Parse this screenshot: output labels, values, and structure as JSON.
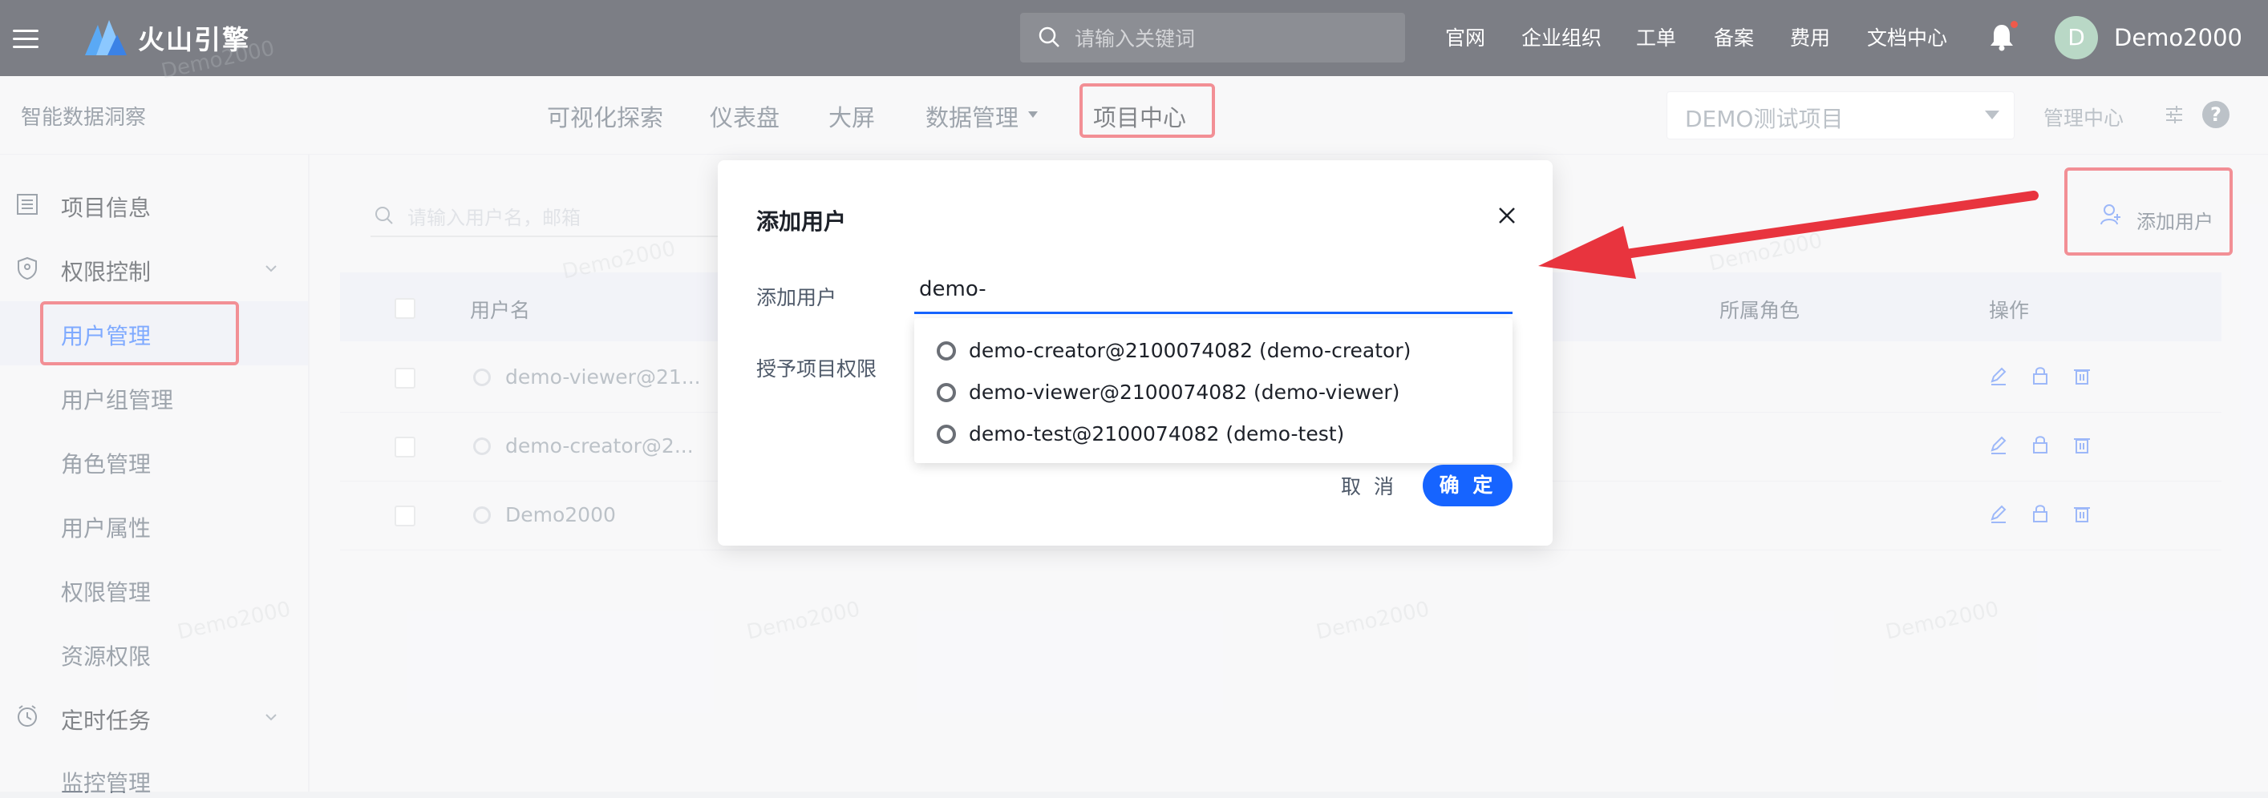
{
  "header": {
    "brand": "火山引擎",
    "search_placeholder": "请输入关键词",
    "links": [
      "官网",
      "企业组织",
      "工单",
      "备案",
      "费用",
      "文档中心"
    ],
    "avatar_letter": "D",
    "username": "Demo2000"
  },
  "subheader": {
    "app_name": "智能数据洞察",
    "tabs": [
      "可视化探索",
      "仪表盘",
      "大屏",
      "数据管理",
      "项目中心"
    ],
    "project": "DEMO测试项目",
    "mgmt_center": "管理中心",
    "help": "?"
  },
  "sidebar": {
    "items": [
      {
        "label": "项目信息"
      },
      {
        "label": "权限控制"
      },
      {
        "label": "用户管理"
      },
      {
        "label": "用户组管理"
      },
      {
        "label": "角色管理"
      },
      {
        "label": "用户属性"
      },
      {
        "label": "权限管理"
      },
      {
        "label": "资源权限"
      },
      {
        "label": "定时任务"
      },
      {
        "label": "监控管理"
      }
    ]
  },
  "main": {
    "search_placeholder": "请输入用户名，邮箱",
    "add_user": "添加用户",
    "columns": [
      "用户名",
      "所属角色",
      "操作"
    ],
    "rows": [
      {
        "name": "demo-viewer@21..."
      },
      {
        "name": "demo-creator@2..."
      },
      {
        "name": "Demo2000"
      }
    ]
  },
  "dialog": {
    "title": "添加用户",
    "label_add": "添加用户",
    "label_grant": "授予项目权限",
    "input_value": "demo-",
    "options": [
      "demo-creator@2100074082 (demo-creator)",
      "demo-viewer@2100074082 (demo-viewer)",
      "demo-test@2100074082 (demo-test)"
    ],
    "cancel": "取 消",
    "ok": "确 定"
  },
  "watermark": "Demo2000",
  "colors": {
    "accent": "#1664ff",
    "highlight": "#e8343e",
    "header_bg": "#7c7e85"
  }
}
